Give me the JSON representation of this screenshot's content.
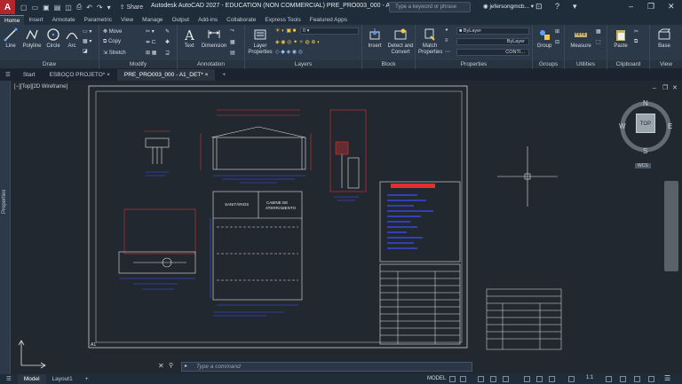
{
  "app": {
    "logo": "A",
    "title": "Autodesk AutoCAD 2027 - EDUCATION (NON COMMERCIAL)    PRE_PRO003_000 - A1_DET.dwg",
    "share": "Share",
    "search_placeholder": "Type a keyword or phrase",
    "user": "jefersongmcb..."
  },
  "ribbon_tabs": [
    "Home",
    "Insert",
    "Annotate",
    "Parametric",
    "View",
    "Manage",
    "Output",
    "Add-ins",
    "Collaborate",
    "Express Tools",
    "Featured Apps"
  ],
  "draw": {
    "title": "Draw",
    "line": "Line",
    "polyline": "Polyline",
    "circle": "Circle",
    "arc": "Arc"
  },
  "modify": {
    "title": "Modify",
    "move": "Move",
    "copy": "Copy",
    "stretch": "Stretch"
  },
  "annotation": {
    "title": "Annotation",
    "text": "Text",
    "dimension": "Dimension"
  },
  "layers": {
    "title": "Layers",
    "layer_properties": "Layer Properties",
    "current_layer": "0"
  },
  "block": {
    "title": "Block",
    "insert": "Insert",
    "detect": "Detect and Convert"
  },
  "properties": {
    "title": "Properties",
    "match": "Match Properties",
    "color": "ByLayer",
    "lineweight": "ByLayer",
    "linetype": "CONTI..."
  },
  "groups": {
    "title": "Groups",
    "group": "Group"
  },
  "utilities": {
    "title": "Utilities",
    "measure": "Measure"
  },
  "clipboard": {
    "title": "Clipboard",
    "paste": "Paste"
  },
  "view": {
    "title": "View",
    "base": "Base"
  },
  "doc_tabs": [
    "Start",
    "ESBOÇO PROJETO*",
    "PRE_PRO003_000 - A1_DET*"
  ],
  "viewport_label": "[−][Top][2D Wireframe]",
  "properties_palette": "Properties",
  "viewcube": {
    "top": "TOP",
    "n": "N",
    "s": "S",
    "e": "E",
    "w": "W",
    "wcs": "WCS"
  },
  "drawing": {
    "room1": "SANITÁRIOS",
    "room2": "CABINE DE\nATERRAMENTO",
    "sheet_ref": "A1"
  },
  "command": {
    "placeholder": "Type a command"
  },
  "layout_tabs": [
    "Model",
    "Layout1"
  ],
  "status": {
    "model": "MODEL",
    "scale": "1:1"
  },
  "colors": {
    "accent": "#4a90d9",
    "blue_line": "#3d4fff",
    "red_line": "#e23030",
    "white_line": "#e6e6e6"
  }
}
